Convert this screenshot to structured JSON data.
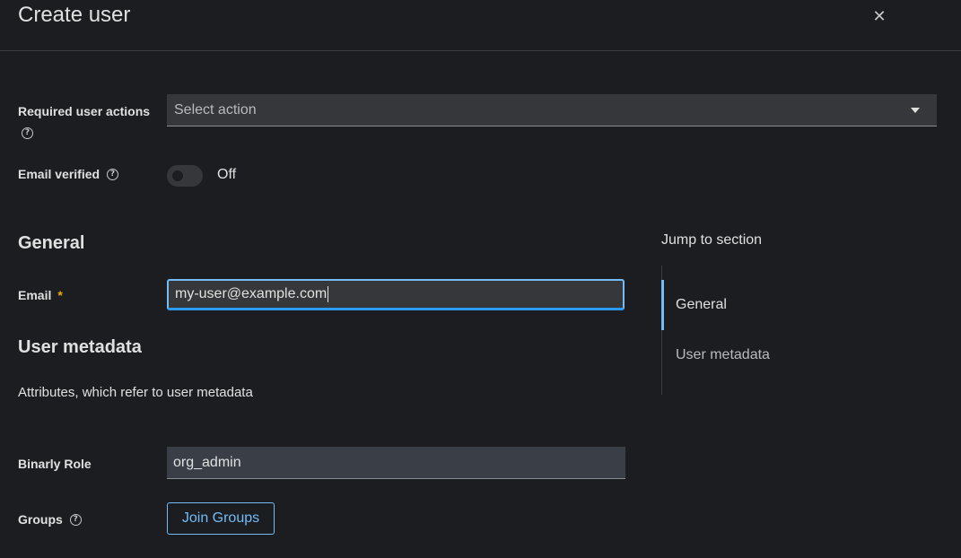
{
  "page": {
    "title": "Create user"
  },
  "fields": {
    "required_actions": {
      "label": "Required user actions",
      "help_icon": "help-circle-icon",
      "placeholder": "Select action",
      "clear_icon": "close-icon",
      "toggle_icon": "caret-down-icon"
    },
    "email_verified": {
      "label": "Email verified",
      "help_icon": "help-circle-icon",
      "state_text": "Off",
      "is_on": false
    }
  },
  "general": {
    "title": "General",
    "email": {
      "label": "Email",
      "required_marker": "*",
      "value": "my-user@example.com"
    }
  },
  "user_metadata": {
    "title": "User metadata",
    "description": "Attributes, which refer to user metadata",
    "binarly_role": {
      "label": "Binarly Role",
      "value": "org_admin"
    },
    "groups": {
      "label": "Groups",
      "help_icon": "help-circle-icon",
      "button_label": "Join Groups"
    }
  },
  "jump_to_section": {
    "title": "Jump to section",
    "items": [
      {
        "label": "General",
        "active": true
      },
      {
        "label": "User metadata",
        "active": false
      }
    ]
  },
  "colors": {
    "background": "#1b1d21",
    "input_background": "#36373a",
    "accent": "#73bcf7",
    "required": "#f0ab00",
    "muted_text": "#b8bbbe"
  }
}
